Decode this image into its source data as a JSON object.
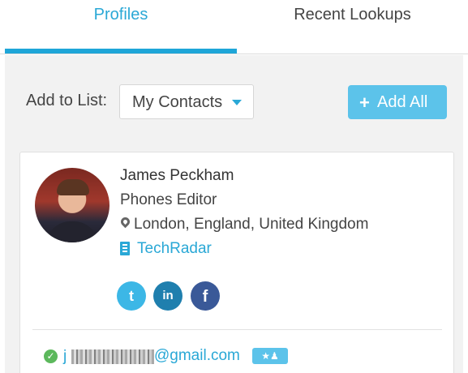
{
  "tabs": {
    "profiles": "Profiles",
    "recent_lookups": "Recent Lookups",
    "active": "Profiles"
  },
  "toolbar": {
    "add_to_list_label": "Add to List:",
    "list_value": "My Contacts",
    "add_all_label": "Add All",
    "add_all_icon": "plus-icon"
  },
  "profile": {
    "name": "James Peckham",
    "title": "Phones Editor",
    "location": "London, England, United Kingdom",
    "company": "TechRadar",
    "social": [
      {
        "network": "twitter",
        "glyph": "t"
      },
      {
        "network": "linkedin",
        "glyph": "in"
      },
      {
        "network": "facebook",
        "glyph": "f"
      }
    ],
    "email": {
      "user_visible": "j",
      "domain": "@gmail.com",
      "verified": true,
      "badge": "★♟"
    }
  },
  "colors": {
    "accent": "#2aa8d6",
    "button": "#5cc3ea",
    "panel_bg": "#f2f2f2",
    "verified": "#5cb85c"
  }
}
